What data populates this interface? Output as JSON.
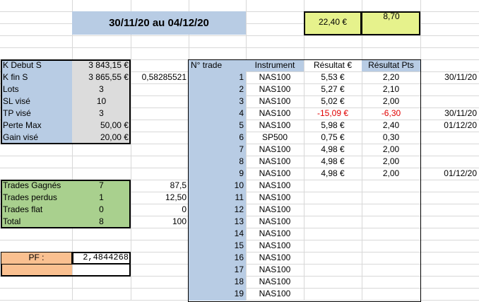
{
  "header": {
    "date_range": "30/11/20 au 04/12/20",
    "total_eur": "22,40 €",
    "total_pts": "8,70"
  },
  "capital": {
    "rows": [
      {
        "label": "K Debut S",
        "value": "3 843,15 €"
      },
      {
        "label": "K fin S",
        "value": "3 865,55 €"
      },
      {
        "label": "Lots",
        "value": "3"
      },
      {
        "label": "SL visé",
        "value": "10"
      },
      {
        "label": "TP visé",
        "value": "3"
      },
      {
        "label": "Perte Max",
        "value": "50,00 €"
      },
      {
        "label": "Gain visé",
        "value": "20,00 €"
      }
    ],
    "ratio": "0,58285521"
  },
  "stats": {
    "rows": [
      {
        "label": "Trades Gagnés",
        "value": "7",
        "pct": "87,5"
      },
      {
        "label": "Trades perdus",
        "value": "1",
        "pct": "12,50"
      },
      {
        "label": "Trades flat",
        "value": "0",
        "pct": "0"
      },
      {
        "label": "Total",
        "value": "8",
        "pct": "100"
      }
    ]
  },
  "pf": {
    "label": "PF :",
    "value": "2,4844268"
  },
  "trades": {
    "headers": {
      "num": "N° trade",
      "instrument": "Instrument",
      "result_eur": "Résultat €",
      "result_pts": "Résultat Pts"
    },
    "rows": [
      {
        "num": "1",
        "instrument": "NAS100",
        "eur": "5,53 €",
        "pts": "2,20",
        "date": "30/11/20"
      },
      {
        "num": "2",
        "instrument": "NAS100",
        "eur": "5,27 €",
        "pts": "2,10",
        "date": ""
      },
      {
        "num": "3",
        "instrument": "NAS100",
        "eur": "5,02 €",
        "pts": "2,00",
        "date": ""
      },
      {
        "num": "4",
        "instrument": "NAS100",
        "eur": "-15,09 €",
        "pts": "-6,30",
        "date": "30/11/20",
        "negative": true
      },
      {
        "num": "5",
        "instrument": "NAS100",
        "eur": "5,98 €",
        "pts": "2,40",
        "date": "01/12/20"
      },
      {
        "num": "6",
        "instrument": "SP500",
        "eur": "0,75 €",
        "pts": "0,30",
        "date": ""
      },
      {
        "num": "7",
        "instrument": "NAS100",
        "eur": "4,98 €",
        "pts": "2,00",
        "date": ""
      },
      {
        "num": "8",
        "instrument": "NAS100",
        "eur": "4,98 €",
        "pts": "2,00",
        "date": ""
      },
      {
        "num": "9",
        "instrument": "NAS100",
        "eur": "4,98 €",
        "pts": "2,00",
        "date": "01/12/20"
      },
      {
        "num": "10",
        "instrument": "NAS100",
        "eur": "",
        "pts": "",
        "date": ""
      },
      {
        "num": "11",
        "instrument": "NAS100",
        "eur": "",
        "pts": "",
        "date": ""
      },
      {
        "num": "12",
        "instrument": "NAS100",
        "eur": "",
        "pts": "",
        "date": ""
      },
      {
        "num": "13",
        "instrument": "NAS100",
        "eur": "",
        "pts": "",
        "date": ""
      },
      {
        "num": "14",
        "instrument": "NAS100",
        "eur": "",
        "pts": "",
        "date": ""
      },
      {
        "num": "15",
        "instrument": "NAS100",
        "eur": "",
        "pts": "",
        "date": ""
      },
      {
        "num": "16",
        "instrument": "NAS100",
        "eur": "",
        "pts": "",
        "date": ""
      },
      {
        "num": "17",
        "instrument": "NAS100",
        "eur": "",
        "pts": "",
        "date": ""
      },
      {
        "num": "18",
        "instrument": "NAS100",
        "eur": "",
        "pts": "",
        "date": ""
      },
      {
        "num": "19",
        "instrument": "NAS100",
        "eur": "",
        "pts": "",
        "date": ""
      }
    ]
  },
  "colors": {
    "header_blue": "#b8cce4",
    "label_grey": "#dcdcdc",
    "stats_green": "#a9d08e",
    "pf_orange": "#fac090",
    "total_yellow": "#e6f28c",
    "negative_red": "#e00000"
  }
}
